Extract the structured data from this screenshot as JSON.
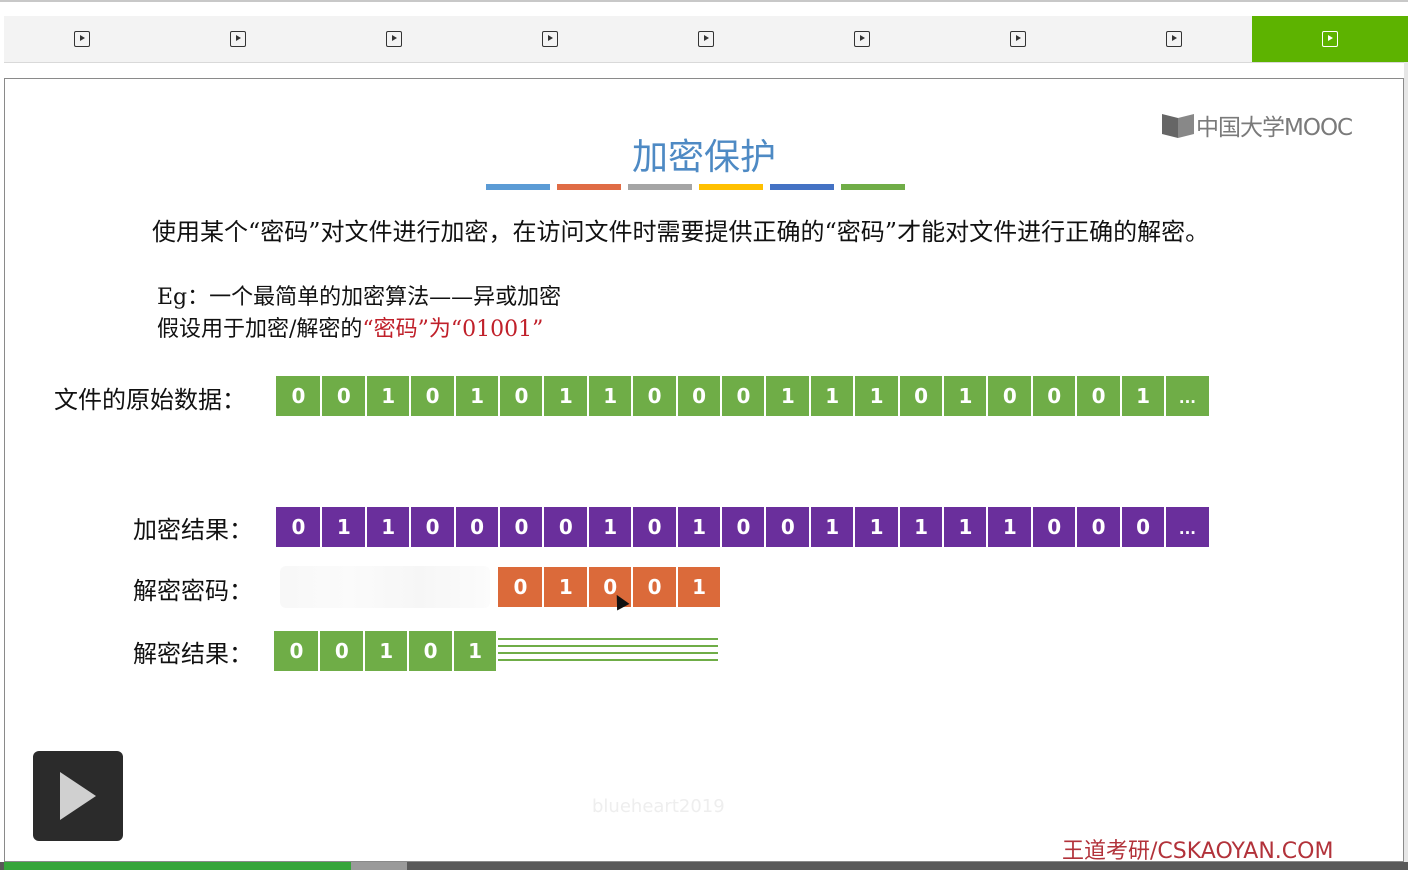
{
  "nav": {
    "tab_count": 9,
    "active_index": 8,
    "active_color": "#5db300"
  },
  "slide": {
    "logo_text": "中国大学MOOC",
    "title": "加密保护",
    "title_bar_colors": [
      "#5b9bd5",
      "#e06c45",
      "#a5a5a5",
      "#ffc000",
      "#4472c4",
      "#70ad47"
    ],
    "description": "使用某个“密码”对文件进行加密，在访问文件时需要提供正确的“密码”才能对文件进行正确的解密。",
    "eg_line1": "Eg：一个最简单的加密算法——异或加密",
    "eg_line2_prefix": "假设用于加密/解密的",
    "eg_line2_highlight": "“密码”为“01001”",
    "rows": {
      "original": {
        "label": "文件的原始数据：",
        "bits": [
          "0",
          "0",
          "1",
          "0",
          "1",
          "0",
          "1",
          "1",
          "0",
          "0",
          "0",
          "1",
          "1",
          "1",
          "0",
          "1",
          "0",
          "0",
          "0",
          "1",
          "..."
        ]
      },
      "encrypted": {
        "label": "加密结果：",
        "bits": [
          "0",
          "1",
          "1",
          "0",
          "0",
          "0",
          "0",
          "1",
          "0",
          "1",
          "0",
          "0",
          "1",
          "1",
          "1",
          "1",
          "1",
          "0",
          "0",
          "0",
          "..."
        ]
      },
      "key": {
        "label": "解密密码：",
        "bits": [
          "0",
          "1",
          "0",
          "0",
          "1"
        ]
      },
      "decrypted": {
        "label": "解密结果：",
        "bits": [
          "0",
          "0",
          "1",
          "0",
          "1"
        ]
      }
    },
    "watermark": "blueheart2019",
    "brand": "王道考研/CSKAOYAN.COM"
  },
  "player": {
    "progress_played": 0.247,
    "progress_buffered": 0.287
  }
}
